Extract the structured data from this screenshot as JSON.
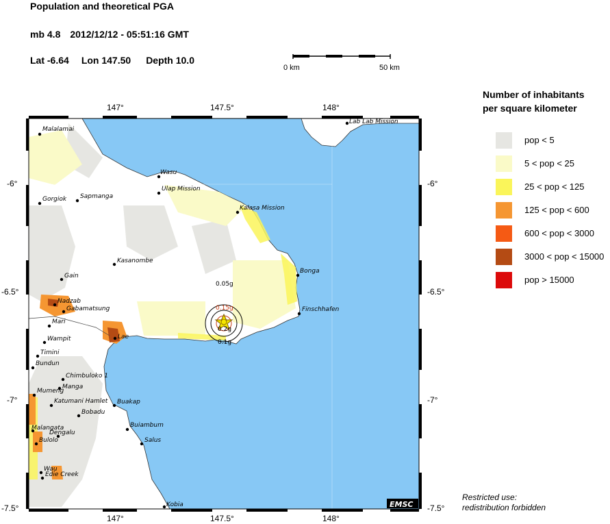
{
  "header": {
    "title": "Population and theoretical PGA",
    "magnitude": "mb 4.8",
    "datetime": "2012/12/12 - 05:51:16 GMT",
    "lat": "Lat -6.64",
    "lon": "Lon 147.50",
    "depth": "Depth  10.0"
  },
  "scale_bar": {
    "left_label": "0 km",
    "right_label": "50 km"
  },
  "axes": {
    "lon_ticks": [
      "147°",
      "147.5°",
      "148°"
    ],
    "lat_ticks": [
      "-6°",
      "-6.5°",
      "-7°",
      "-7.5°"
    ]
  },
  "legend": {
    "title_line1": "Number of inhabitants",
    "title_line2": "per square kilometer",
    "items": [
      {
        "label": "pop < 5",
        "color": "#e6e6e2"
      },
      {
        "label": "5 < pop < 25",
        "color": "#fafac8"
      },
      {
        "label": "25 < pop < 125",
        "color": "#faf55a"
      },
      {
        "label": "125 < pop < 600",
        "color": "#f59632"
      },
      {
        "label": "600 < pop < 3000",
        "color": "#f55a14"
      },
      {
        "label": "3000 < pop < 15000",
        "color": "#b44b14"
      },
      {
        "label": "pop > 15000",
        "color": "#dc0a0a"
      }
    ]
  },
  "places": [
    "Malalamai",
    "Wasu",
    "Ulap Mission",
    "Gorgiok",
    "Sapmanga",
    "Kalasa Mission",
    "Kasanombe",
    "Bonga",
    "Gain",
    "Nadzab",
    "Gabamatsung",
    "Finschhafen",
    "Mari",
    "Lae",
    "Wampit",
    "Timini",
    "Bundun",
    "Chimbuloko 1",
    "Manga",
    "Mumeng",
    "Katumani Hamlet",
    "Buakap",
    "Bobadu",
    "Buiambum",
    "Malangata",
    "Dengalu",
    "Salus",
    "Bulolo",
    "Wau",
    "Edie Creek",
    "Kobia",
    "Lab Lab Mission"
  ],
  "pga_labels": [
    "0.05g",
    "0.15g",
    "0.2g",
    "0.1g"
  ],
  "map_badge": "EMSC",
  "footer": {
    "line1": "Restricted use:",
    "line2": "redistribution forbidden"
  },
  "colors": {
    "sea": "#87c8f5",
    "land": "#ffffff",
    "epicenter_star": "#f5e600"
  }
}
